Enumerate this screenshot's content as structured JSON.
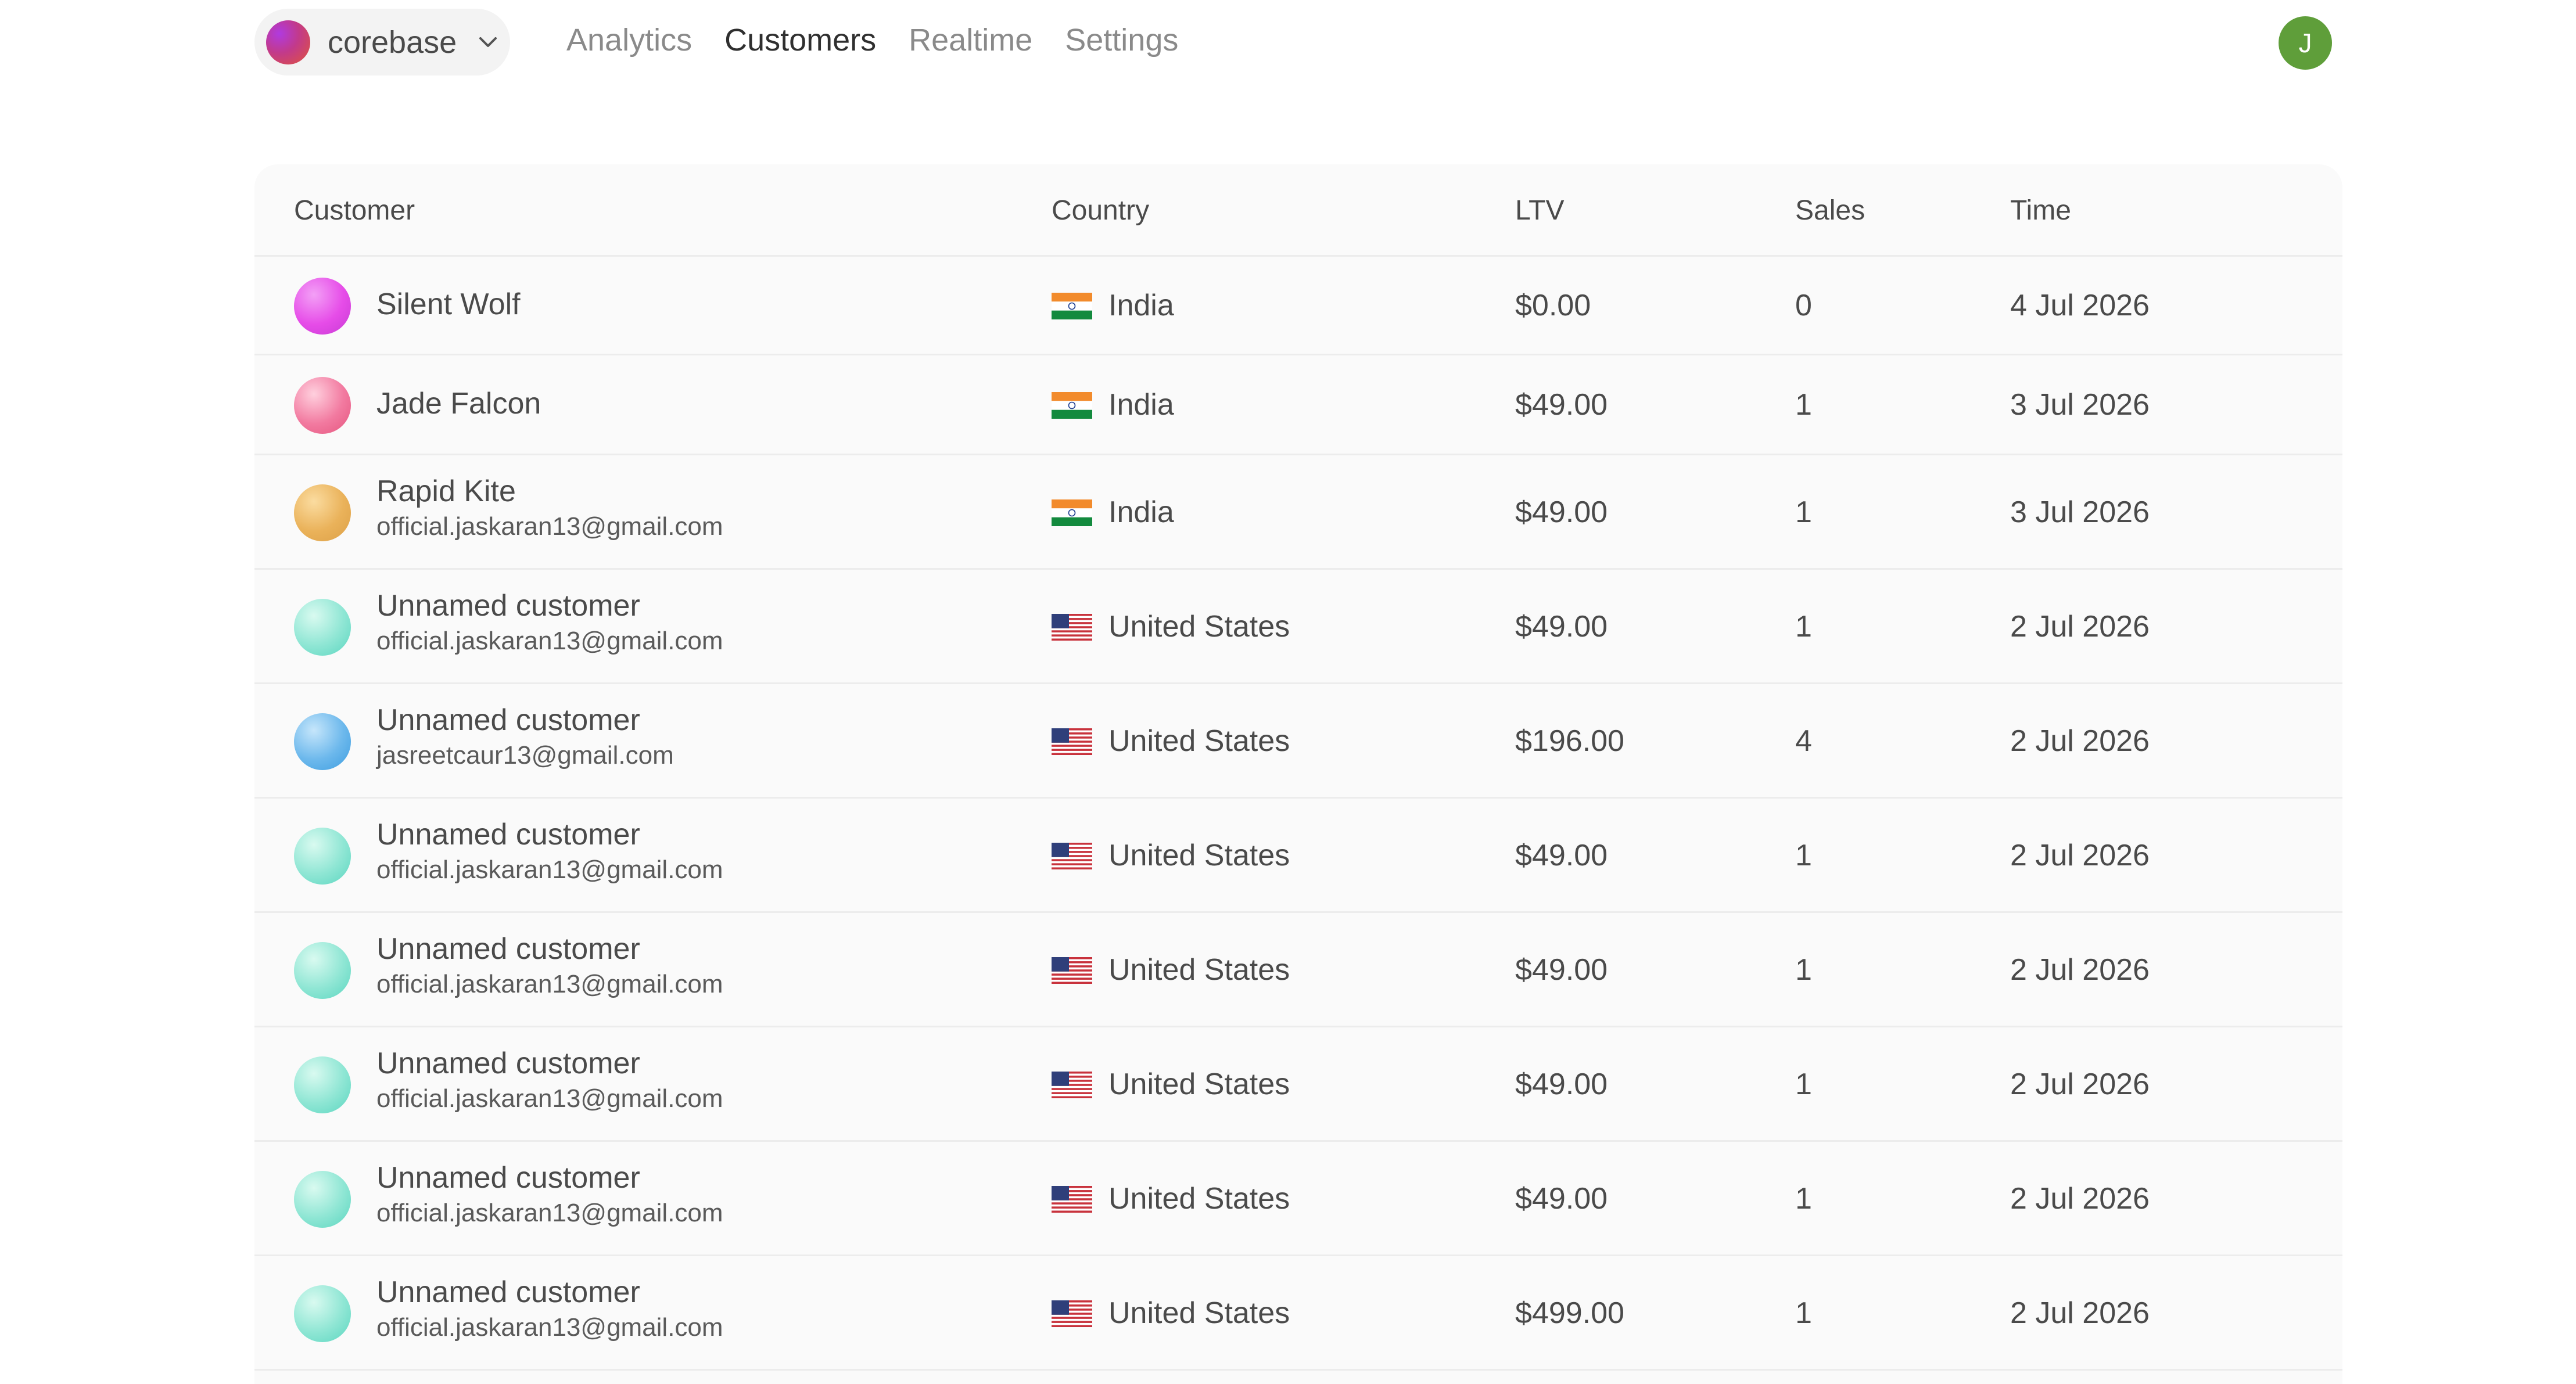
{
  "workspace": {
    "name": "corebase"
  },
  "nav": [
    {
      "label": "Analytics",
      "active": false
    },
    {
      "label": "Customers",
      "active": true
    },
    {
      "label": "Realtime",
      "active": false
    },
    {
      "label": "Settings",
      "active": false
    }
  ],
  "user": {
    "initial": "J",
    "avatar_color": "#5f9e3a"
  },
  "table": {
    "columns": {
      "customer": "Customer",
      "country": "Country",
      "ltv": "LTV",
      "sales": "Sales",
      "time": "Time"
    },
    "rows": [
      {
        "name": "Silent Wolf",
        "email": "",
        "avatar": [
          "#f3a0f6",
          "#e64ce8",
          "#c73ad4"
        ],
        "flag": "india-flag-icon",
        "country": "India",
        "ltv": "$0.00",
        "sales": "0",
        "time": "4 Jul 2026"
      },
      {
        "name": "Jade Falcon",
        "email": "",
        "avatar": [
          "#ffd0de",
          "#f27aa0",
          "#e5557e"
        ],
        "flag": "india-flag-icon",
        "country": "India",
        "ltv": "$49.00",
        "sales": "1",
        "time": "3 Jul 2026"
      },
      {
        "name": "Rapid Kite",
        "email": "official.jaskaran13@gmail.com",
        "avatar": [
          "#fbdca0",
          "#eab25a",
          "#dca047"
        ],
        "flag": "india-flag-icon",
        "country": "India",
        "ltv": "$49.00",
        "sales": "1",
        "time": "3 Jul 2026"
      },
      {
        "name": "Unnamed customer",
        "email": "official.jaskaran13@gmail.com",
        "avatar": [
          "#d9faf0",
          "#8fe6d4",
          "#5ad6c0"
        ],
        "flag": "us-flag-icon",
        "country": "United States",
        "ltv": "$49.00",
        "sales": "1",
        "time": "2 Jul 2026"
      },
      {
        "name": "Unnamed customer",
        "email": "jasreetcaur13@gmail.com",
        "avatar": [
          "#c6e6fb",
          "#6cb8ec",
          "#3d9de0"
        ],
        "flag": "us-flag-icon",
        "country": "United States",
        "ltv": "$196.00",
        "sales": "4",
        "time": "2 Jul 2026"
      },
      {
        "name": "Unnamed customer",
        "email": "official.jaskaran13@gmail.com",
        "avatar": [
          "#d9faf0",
          "#8fe6d4",
          "#5ad6c0"
        ],
        "flag": "us-flag-icon",
        "country": "United States",
        "ltv": "$49.00",
        "sales": "1",
        "time": "2 Jul 2026"
      },
      {
        "name": "Unnamed customer",
        "email": "official.jaskaran13@gmail.com",
        "avatar": [
          "#d9faf0",
          "#8fe6d4",
          "#5ad6c0"
        ],
        "flag": "us-flag-icon",
        "country": "United States",
        "ltv": "$49.00",
        "sales": "1",
        "time": "2 Jul 2026"
      },
      {
        "name": "Unnamed customer",
        "email": "official.jaskaran13@gmail.com",
        "avatar": [
          "#d9faf0",
          "#8fe6d4",
          "#5ad6c0"
        ],
        "flag": "us-flag-icon",
        "country": "United States",
        "ltv": "$49.00",
        "sales": "1",
        "time": "2 Jul 2026"
      },
      {
        "name": "Unnamed customer",
        "email": "official.jaskaran13@gmail.com",
        "avatar": [
          "#d9faf0",
          "#8fe6d4",
          "#5ad6c0"
        ],
        "flag": "us-flag-icon",
        "country": "United States",
        "ltv": "$49.00",
        "sales": "1",
        "time": "2 Jul 2026"
      },
      {
        "name": "Unnamed customer",
        "email": "official.jaskaran13@gmail.com",
        "avatar": [
          "#d9faf0",
          "#8fe6d4",
          "#5ad6c0"
        ],
        "flag": "us-flag-icon",
        "country": "United States",
        "ltv": "$499.00",
        "sales": "1",
        "time": "2 Jul 2026"
      }
    ]
  }
}
